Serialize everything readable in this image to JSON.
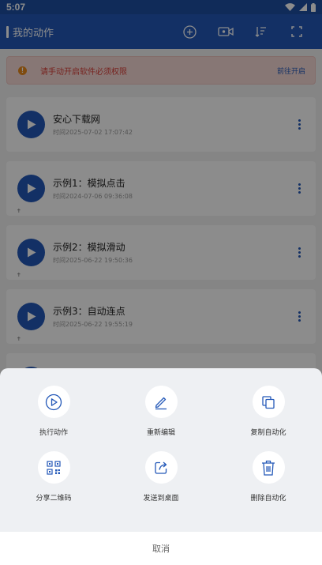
{
  "status_bar": {
    "time": "5:07"
  },
  "app_bar": {
    "title": "我的动作",
    "actions": [
      "add-circle-icon",
      "video-record-icon",
      "sort-icon",
      "fullscreen-icon"
    ]
  },
  "notice": {
    "icon": "warning-icon",
    "text": "请手动开启软件必须权限",
    "link": "前往开启"
  },
  "actions": [
    {
      "title": "安心下载网",
      "time": "时间2025-07-02 17:07:42"
    },
    {
      "title": "示例1：模拟点击",
      "time": "时间2024-07-06 09:36:08"
    },
    {
      "title": "示例2：模拟滑动",
      "time": "时间2025-06-22 19:50:36"
    },
    {
      "title": "示例3：自动连点",
      "time": "时间2025-06-22 19:55:19"
    }
  ],
  "sheet": {
    "items": [
      {
        "label": "执行动作",
        "icon": "play-circle-icon"
      },
      {
        "label": "重新编辑",
        "icon": "edit-icon"
      },
      {
        "label": "复制自动化",
        "icon": "copy-icon"
      },
      {
        "label": "分享二维码",
        "icon": "qr-code-icon"
      },
      {
        "label": "发送到桌面",
        "icon": "share-to-desktop-icon"
      },
      {
        "label": "删除自动化",
        "icon": "trash-icon"
      }
    ],
    "cancel_label": "取消"
  },
  "colors": {
    "primary": "#2358b8",
    "warning": "#e8891c",
    "danger_text": "#d9403a"
  }
}
